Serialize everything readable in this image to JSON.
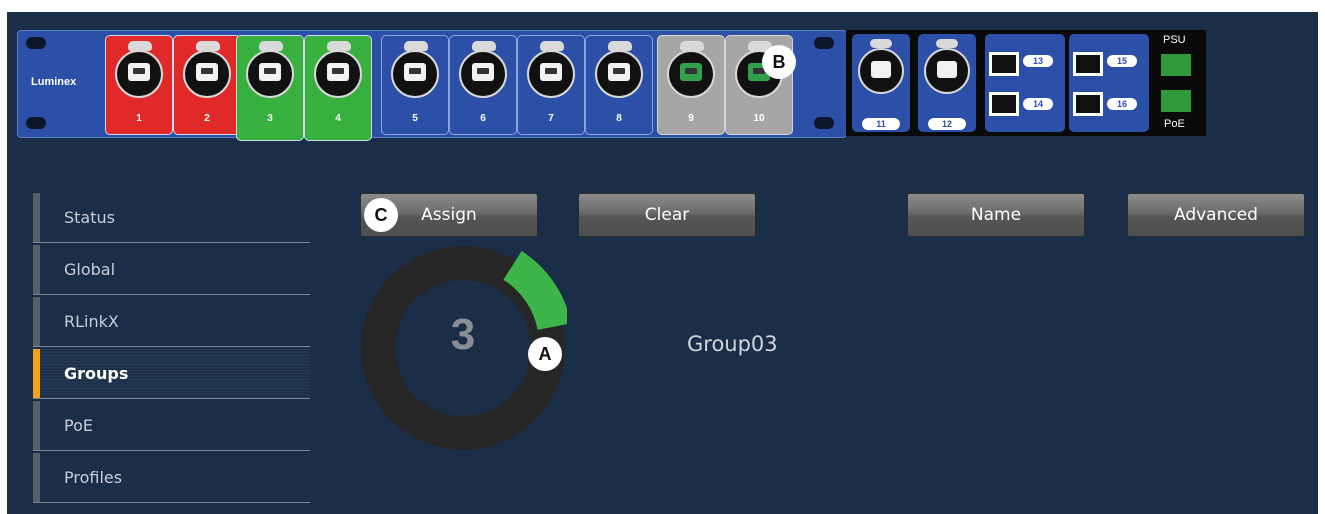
{
  "brand": "Luminex",
  "ports": [
    {
      "num": "1",
      "color": "#e02a2a"
    },
    {
      "num": "2",
      "color": "#e02a2a"
    },
    {
      "num": "3",
      "color": "#37b03f"
    },
    {
      "num": "4",
      "color": "#37b03f"
    },
    {
      "num": "5",
      "color": "#2c50a8"
    },
    {
      "num": "6",
      "color": "#2c50a8"
    },
    {
      "num": "7",
      "color": "#2c50a8"
    },
    {
      "num": "8",
      "color": "#2c50a8"
    },
    {
      "num": "9",
      "color": "#a6a6a6"
    },
    {
      "num": "10",
      "color": "#a6a6a6"
    }
  ],
  "module": {
    "ports": [
      "11",
      "12"
    ],
    "sfp": [
      "13",
      "14",
      "15",
      "16"
    ],
    "psu_label": "PSU",
    "poe_label": "PoE"
  },
  "sidebar": {
    "items": [
      {
        "label": "Status"
      },
      {
        "label": "Global"
      },
      {
        "label": "RLinkX"
      },
      {
        "label": "Groups",
        "active": true
      },
      {
        "label": "PoE"
      },
      {
        "label": "Profiles"
      }
    ]
  },
  "toolbar": {
    "assign": "Assign",
    "clear": "Clear",
    "name": "Name",
    "advanced": "Advanced"
  },
  "group": {
    "number": "3",
    "name": "Group03",
    "segment_color": "#3db549",
    "ring_color": "#262626"
  },
  "callouts": {
    "a": "A",
    "b": "B",
    "c": "C"
  },
  "colors": {
    "background": "#1a2e48",
    "active_accent": "#f3a21a"
  }
}
